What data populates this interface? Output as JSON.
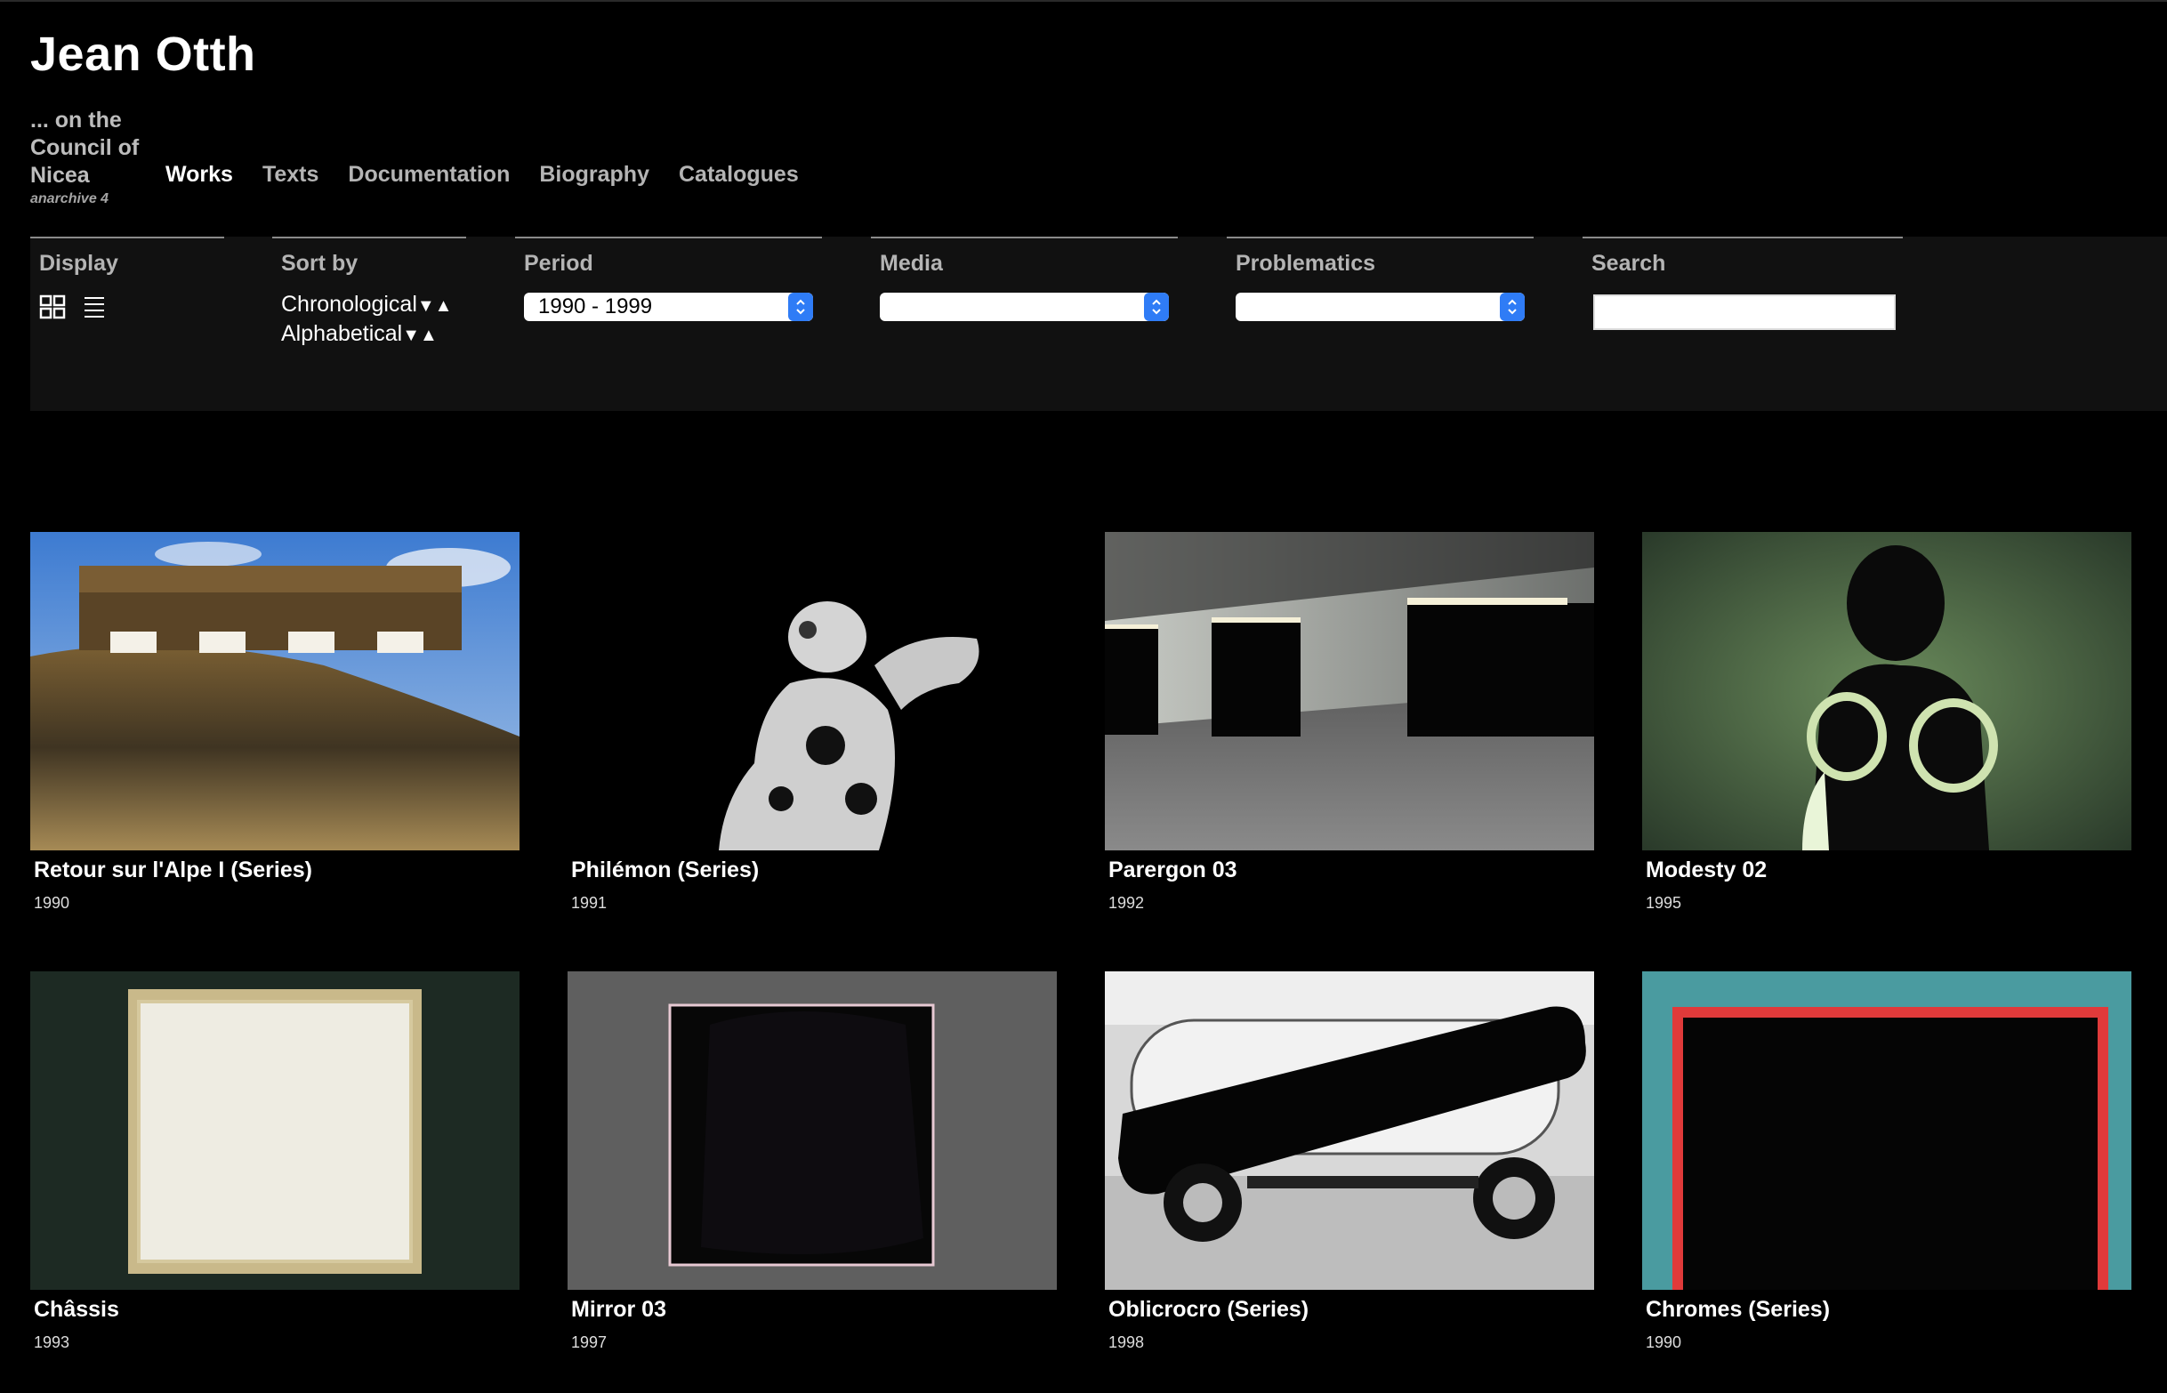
{
  "site": {
    "title": "Jean Otth",
    "brand_line1": "... on the",
    "brand_line2": "Council of",
    "brand_line3": "Nicea",
    "brand_sub": "anarchive 4"
  },
  "nav": {
    "items": [
      {
        "label": "Works",
        "active": true
      },
      {
        "label": "Texts"
      },
      {
        "label": "Documentation"
      },
      {
        "label": "Biography"
      },
      {
        "label": "Catalogues"
      }
    ]
  },
  "filters": {
    "display_label": "Display",
    "display_icons": [
      "grid-view-icon",
      "list-view-icon"
    ],
    "sort_label": "Sort by",
    "sort_chrono": "Chronological",
    "sort_alpha": "Alphabetical",
    "sort_arrows": "▼▲",
    "period_label": "Period",
    "period_value": "1990 - 1999",
    "media_label": "Media",
    "media_value": "",
    "problematics_label": "Problematics",
    "problematics_value": "",
    "search_label": "Search",
    "search_value": ""
  },
  "works": [
    {
      "title": "Retour sur l'Alpe I (Series)",
      "year": "1990"
    },
    {
      "title": "Philémon (Series)",
      "year": "1991"
    },
    {
      "title": "Parergon 03",
      "year": "1992"
    },
    {
      "title": "Modesty 02",
      "year": "1995"
    },
    {
      "title": "Châssis",
      "year": "1993"
    },
    {
      "title": "Mirror 03",
      "year": "1997"
    },
    {
      "title": "Oblicrocro (Series)",
      "year": "1998"
    },
    {
      "title": "Chromes (Series)",
      "year": "1990"
    }
  ],
  "colors": {
    "background": "#000000",
    "panel": "#111111",
    "select_accent": "#2f7cf6"
  }
}
